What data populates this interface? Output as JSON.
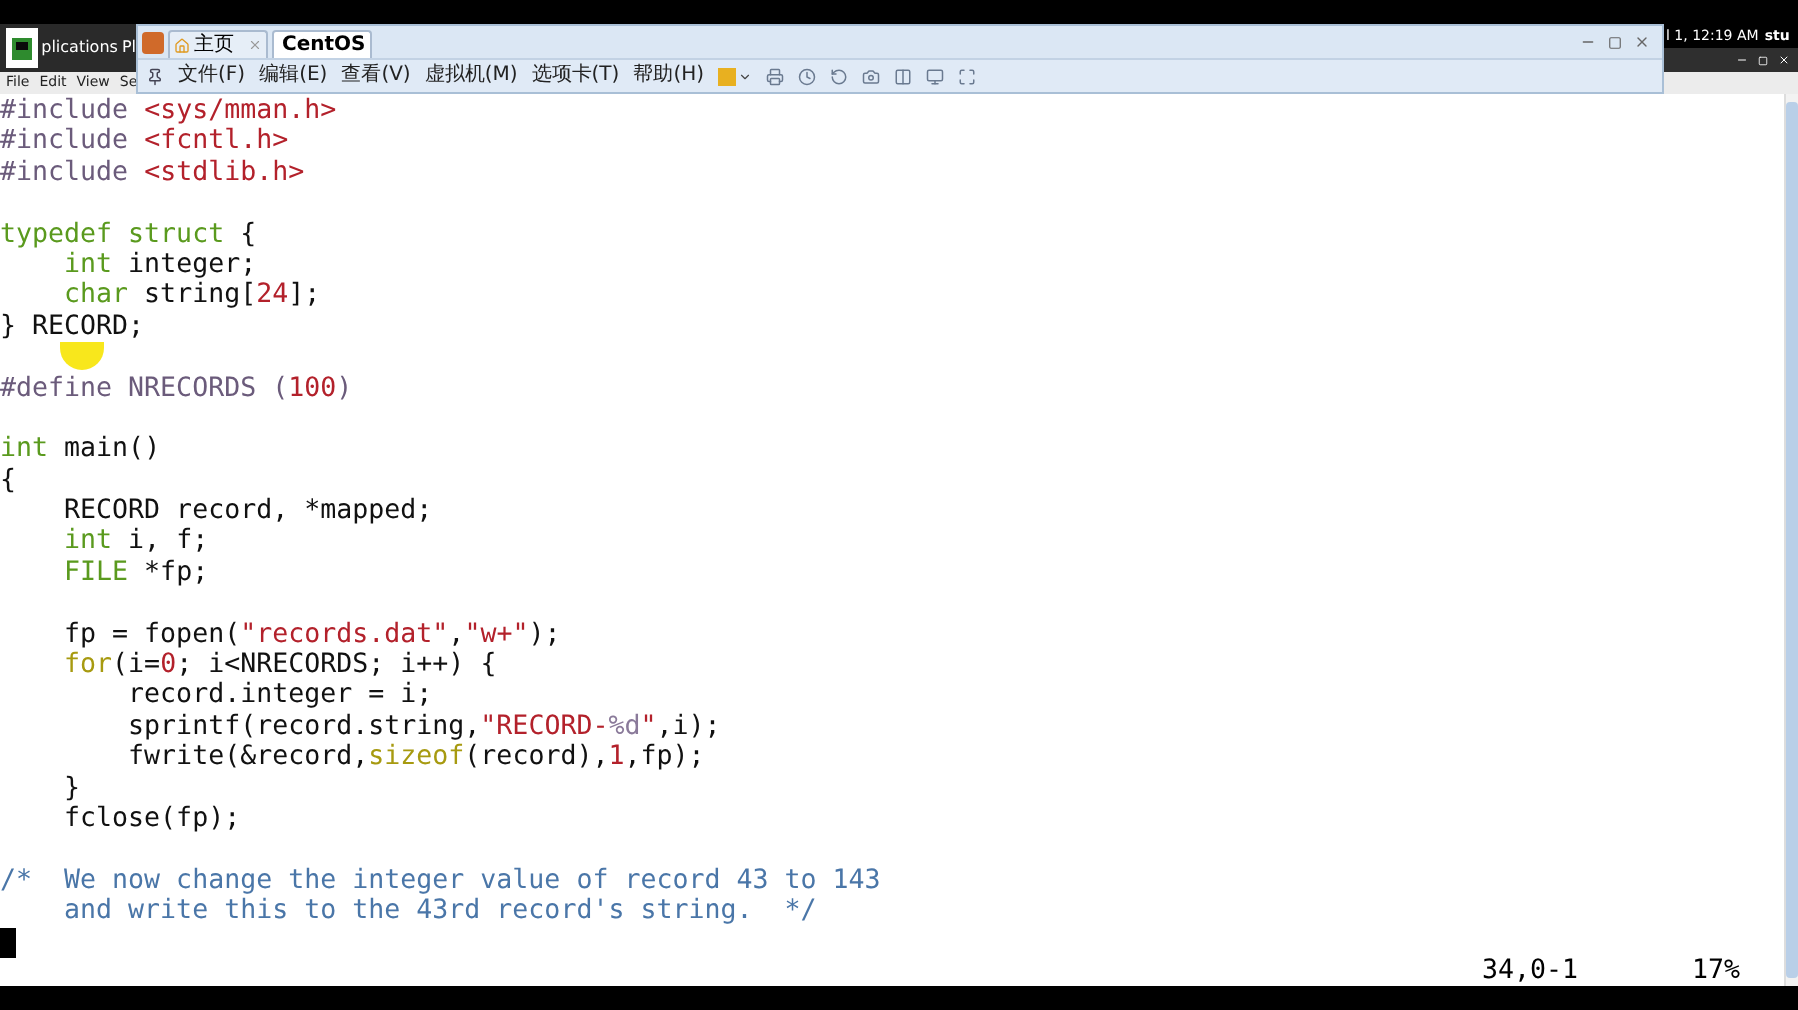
{
  "desktop_panel": {
    "menu_fragment": "plications",
    "menu_fragment_2": "Pl",
    "clock": "l 1, 12:19 AM",
    "user": "stu"
  },
  "terminal_menu": [
    "File",
    "Edit",
    "View",
    "Se"
  ],
  "vm_window": {
    "tabs": [
      {
        "label": "主页",
        "selected": false
      },
      {
        "label": "CentOS",
        "selected": true
      }
    ],
    "menu": [
      "文件(F)",
      "编辑(E)",
      "查看(V)",
      "虚拟机(M)",
      "选项卡(T)",
      "帮助(H)"
    ]
  },
  "editor": {
    "lines": [
      {
        "kind": "code",
        "segments": [
          {
            "text": "#include ",
            "kind": "preproc"
          },
          {
            "text": "<sys/mman.h>",
            "kind": "string"
          }
        ]
      },
      {
        "kind": "code",
        "segments": [
          {
            "text": "#include ",
            "kind": "preproc"
          },
          {
            "text": "<fcntl.h>",
            "kind": "string"
          }
        ]
      },
      {
        "kind": "code",
        "segments": [
          {
            "text": "#include ",
            "kind": "preproc"
          },
          {
            "text": "<stdlib.h>",
            "kind": "string"
          }
        ]
      },
      {
        "kind": "blank"
      },
      {
        "kind": "code",
        "segments": [
          {
            "text": "typedef struct",
            "kind": "type"
          },
          {
            "text": " {",
            "kind": "plain"
          }
        ]
      },
      {
        "kind": "code",
        "segments": [
          {
            "text": "    int",
            "kind": "type"
          },
          {
            "text": " integer;",
            "kind": "plain"
          }
        ]
      },
      {
        "kind": "code",
        "segments": [
          {
            "text": "    char",
            "kind": "type"
          },
          {
            "text": " string[",
            "kind": "plain"
          },
          {
            "text": "24",
            "kind": "number"
          },
          {
            "text": "];",
            "kind": "plain"
          }
        ]
      },
      {
        "kind": "code",
        "segments": [
          {
            "text": "} RECORD;",
            "kind": "plain"
          }
        ]
      },
      {
        "kind": "blank"
      },
      {
        "kind": "code",
        "segments": [
          {
            "text": "#define NRECORDS (",
            "kind": "preproc"
          },
          {
            "text": "100",
            "kind": "number"
          },
          {
            "text": ")",
            "kind": "preproc"
          }
        ]
      },
      {
        "kind": "blank"
      },
      {
        "kind": "code",
        "segments": [
          {
            "text": "int",
            "kind": "type"
          },
          {
            "text": " main()",
            "kind": "plain"
          }
        ]
      },
      {
        "kind": "code",
        "segments": [
          {
            "text": "{",
            "kind": "plain"
          }
        ]
      },
      {
        "kind": "code",
        "segments": [
          {
            "text": "    RECORD record, *mapped;",
            "kind": "plain"
          }
        ]
      },
      {
        "kind": "code",
        "segments": [
          {
            "text": "    int",
            "kind": "type"
          },
          {
            "text": " i, f;",
            "kind": "plain"
          }
        ]
      },
      {
        "kind": "code",
        "segments": [
          {
            "text": "    FILE",
            "kind": "type"
          },
          {
            "text": " *fp;",
            "kind": "plain"
          }
        ]
      },
      {
        "kind": "blank"
      },
      {
        "kind": "code",
        "segments": [
          {
            "text": "    fp = fopen(",
            "kind": "plain"
          },
          {
            "text": "\"records.dat\"",
            "kind": "string"
          },
          {
            "text": ",",
            "kind": "plain"
          },
          {
            "text": "\"w+\"",
            "kind": "string"
          },
          {
            "text": ");",
            "kind": "plain"
          }
        ]
      },
      {
        "kind": "code",
        "segments": [
          {
            "text": "    for",
            "kind": "keyword"
          },
          {
            "text": "(i=",
            "kind": "plain"
          },
          {
            "text": "0",
            "kind": "number"
          },
          {
            "text": "; i<NRECORDS; i++) {",
            "kind": "plain"
          }
        ]
      },
      {
        "kind": "code",
        "segments": [
          {
            "text": "        record.integer = i;",
            "kind": "plain"
          }
        ]
      },
      {
        "kind": "code",
        "segments": [
          {
            "text": "        sprintf(record.string,",
            "kind": "plain"
          },
          {
            "text": "\"RECORD-",
            "kind": "string"
          },
          {
            "text": "%d",
            "kind": "special"
          },
          {
            "text": "\"",
            "kind": "string"
          },
          {
            "text": ",i);",
            "kind": "plain"
          }
        ]
      },
      {
        "kind": "code",
        "segments": [
          {
            "text": "        fwrite(&record,",
            "kind": "plain"
          },
          {
            "text": "sizeof",
            "kind": "keyword"
          },
          {
            "text": "(record),",
            "kind": "plain"
          },
          {
            "text": "1",
            "kind": "number"
          },
          {
            "text": ",fp);",
            "kind": "plain"
          }
        ]
      },
      {
        "kind": "code",
        "segments": [
          {
            "text": "    }",
            "kind": "plain"
          }
        ]
      },
      {
        "kind": "code",
        "segments": [
          {
            "text": "    fclose(fp);",
            "kind": "plain"
          }
        ]
      },
      {
        "kind": "blank"
      },
      {
        "kind": "code",
        "segments": [
          {
            "text": "/*  We now change the integer value of record 43 to 143",
            "kind": "comment"
          }
        ]
      },
      {
        "kind": "code",
        "segments": [
          {
            "text": "    and write this to the 43rd record's string.  */",
            "kind": "comment"
          }
        ]
      },
      {
        "kind": "cursor"
      }
    ],
    "status": {
      "position": "34,0-1",
      "percent": "17%"
    }
  }
}
